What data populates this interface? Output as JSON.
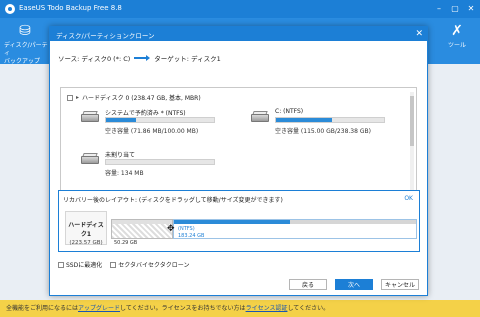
{
  "app": {
    "title": "EaseUS Todo Backup Free 8.8",
    "toolbar_left_label": "ディスク/パーティ\nバックアップ",
    "toolbar_right_label": "ツール"
  },
  "dialog": {
    "title": "ディスク/パーティションクローン",
    "route_source": "ソース: ディスク0 (*: C)",
    "route_target": "ターゲット: ディスク1"
  },
  "disk": {
    "header": "ハードディスク 0 (238.47 GB, 基本, MBR)",
    "partitions": [
      {
        "name": "システムで予約済み * (NTFS)",
        "free": "空き容量 (71.86 MB/100.00 MB)",
        "used_ratio": 0.28
      },
      {
        "name": "C: (NTFS)",
        "free": "空き容量 (115.00 GB/238.38 GB)",
        "used_ratio": 0.52
      },
      {
        "name": "未割り当て",
        "free": "容量: 134 MB",
        "used_ratio": 0.0
      }
    ]
  },
  "layout": {
    "title": "リカバリー後のレイアウト: (ディスクをドラッグして移動/サイズ変更ができます)",
    "ok": "OK",
    "disk_name": "ハードディスク1",
    "disk_size": "(223.57 GB)",
    "free_label": "50.29 GB",
    "part_label1": "(NTFS)",
    "part_label2": "183.24 GB",
    "fill_ratio": 0.48
  },
  "options": {
    "ssd": "SSDに最適化",
    "sector": "セクタバイセクタクローン"
  },
  "buttons": {
    "back": "戻る",
    "next": "次へ",
    "cancel": "キャンセル"
  },
  "footer": {
    "text_before": "全機能をご利用になるには",
    "link1": "アップグレード",
    "text_mid": "してください。ライセンスをお持ちでない方は",
    "link2": "ライセンス認証",
    "text_after": "してください。"
  }
}
